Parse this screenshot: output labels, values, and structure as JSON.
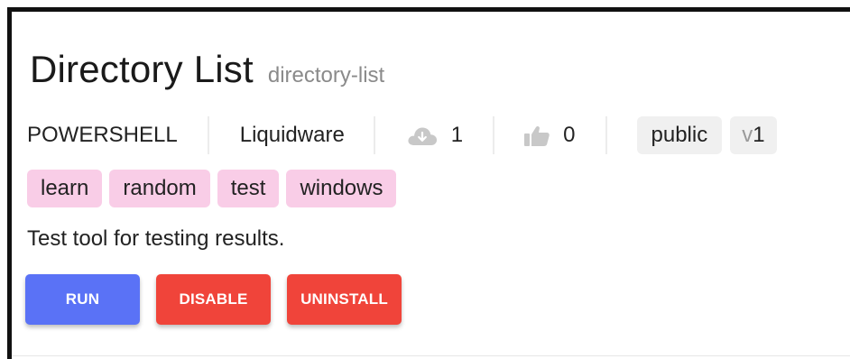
{
  "tool": {
    "title": "Directory List",
    "slug": "directory-list",
    "type": "POWERSHELL",
    "vendor": "Liquidware",
    "downloads": "1",
    "likes": "0",
    "visibility": "public",
    "version_prefix": "v",
    "version_number": "1",
    "tags": [
      "learn",
      "random",
      "test",
      "windows"
    ],
    "description": "Test tool for testing results."
  },
  "actions": {
    "run_label": "RUN",
    "disable_label": "DISABLE",
    "uninstall_label": "UNINSTALL"
  },
  "icons": {
    "downloads": "cloud-download-icon",
    "likes": "thumbs-up-icon"
  },
  "colors": {
    "run": "#5a72f6",
    "danger": "#f0443a",
    "tag_bg": "#f9cde7",
    "chip_bg": "#f0f0f0",
    "icon_gray": "#c8c8c8"
  }
}
